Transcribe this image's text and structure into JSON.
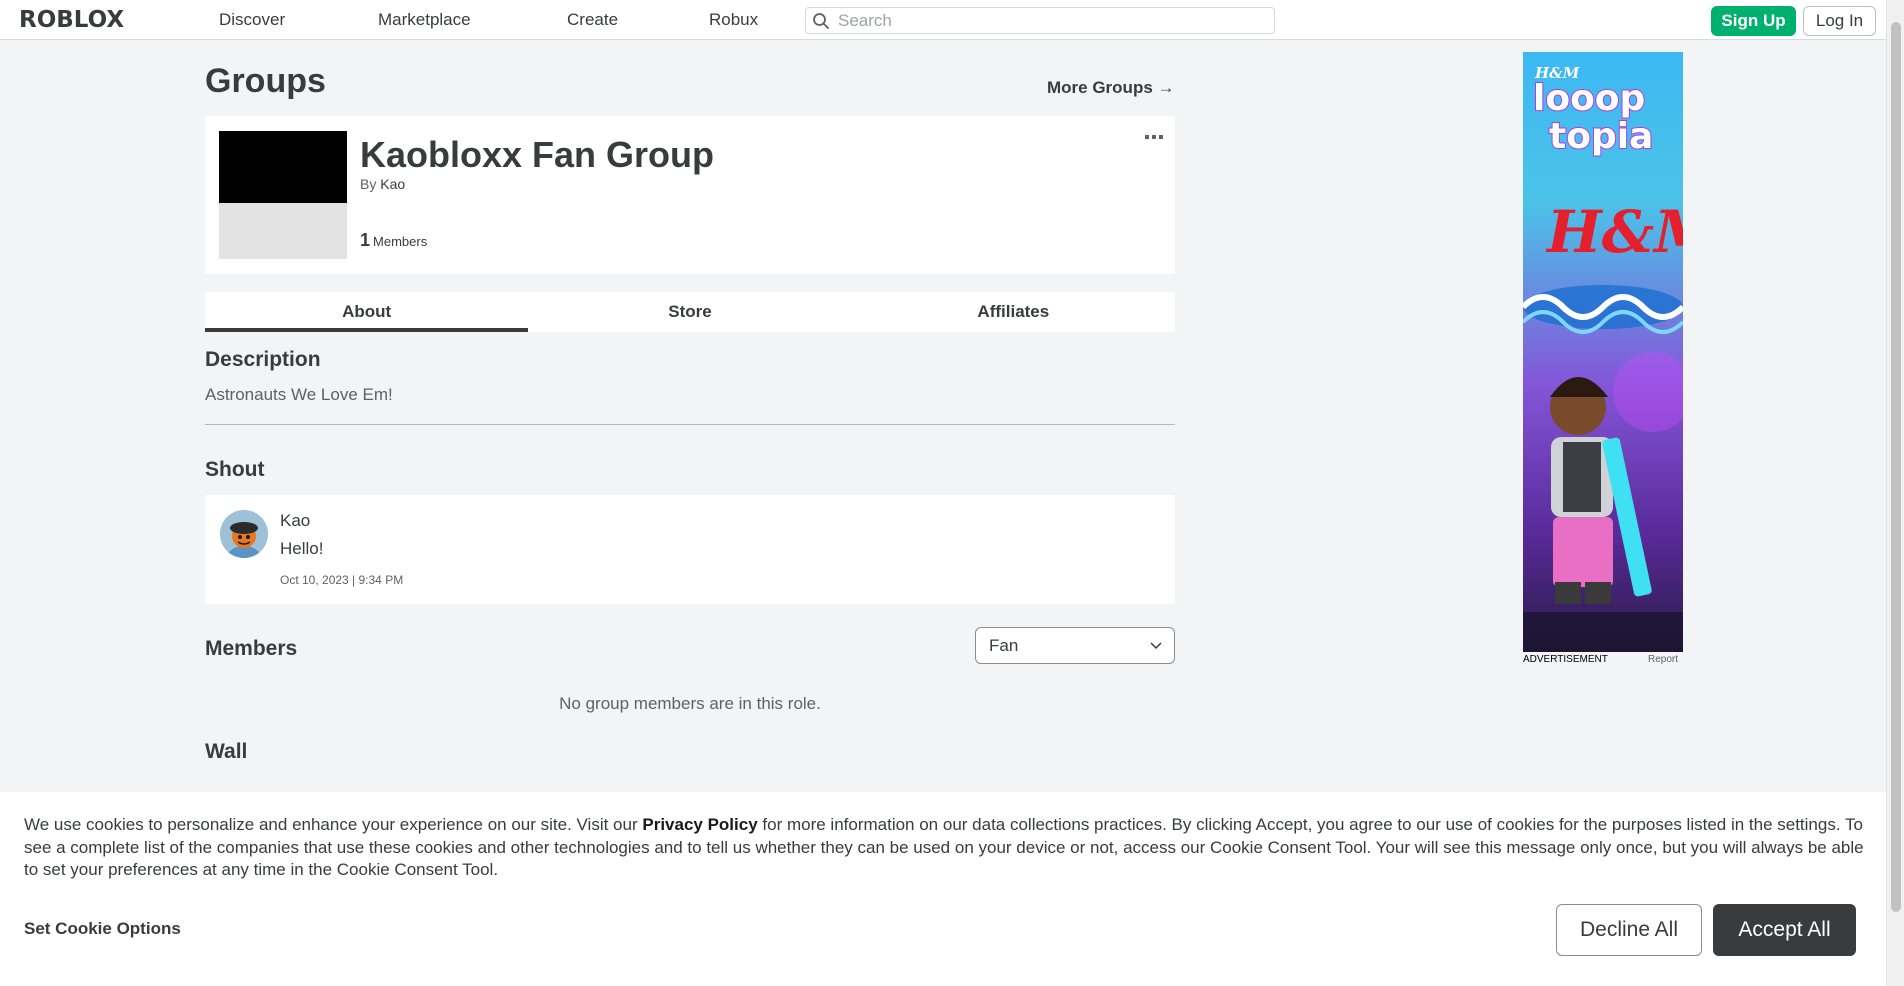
{
  "header": {
    "logo": "ROBLOX",
    "nav": [
      "Discover",
      "Marketplace",
      "Create",
      "Robux"
    ],
    "search_placeholder": "Search",
    "signup_label": "Sign Up",
    "login_label": "Log In"
  },
  "page": {
    "title": "Groups",
    "more_groups": "More Groups",
    "more_groups_arrow": "→"
  },
  "group": {
    "name": "Kaobloxx Fan Group",
    "by_label": "By",
    "owner": "Kao",
    "member_count": "1",
    "member_label": "Members"
  },
  "tabs": [
    "About",
    "Store",
    "Affiliates"
  ],
  "about": {
    "description_title": "Description",
    "description": "Astronauts We Love Em!",
    "shout_title": "Shout",
    "shout": {
      "author": "Kao",
      "body": "Hello!",
      "time": "Oct 10, 2023 | 9:34 PM"
    },
    "members_title": "Members",
    "role_selected": "Fan",
    "no_members": "No group members are in this role.",
    "wall_title": "Wall"
  },
  "ad": {
    "label": "ADVERTISEMENT",
    "report": "Report",
    "brand_small": "H&M",
    "headline_1": "looop",
    "headline_2": "topia",
    "brand_large": "H&M"
  },
  "cookie": {
    "text_before": "We use cookies to personalize and enhance your experience on our site. Visit our ",
    "privacy_link": "Privacy Policy",
    "text_after": " for more information on our data collections practices. By clicking Accept, you agree to our use of cookies for the purposes listed in the settings. To see a complete list of the companies that use these cookies and other technologies and to tell us whether they can be used on your device or not, access our Cookie Consent Tool. Your will see this message only once, but you will always be able to set your preferences at any time in the Cookie Consent Tool.",
    "set_options": "Set Cookie Options",
    "decline": "Decline All",
    "accept": "Accept All"
  },
  "colors": {
    "signup_green": "#00b06f",
    "dark_button": "#393b3d",
    "page_bg": "#f2f4f5"
  }
}
